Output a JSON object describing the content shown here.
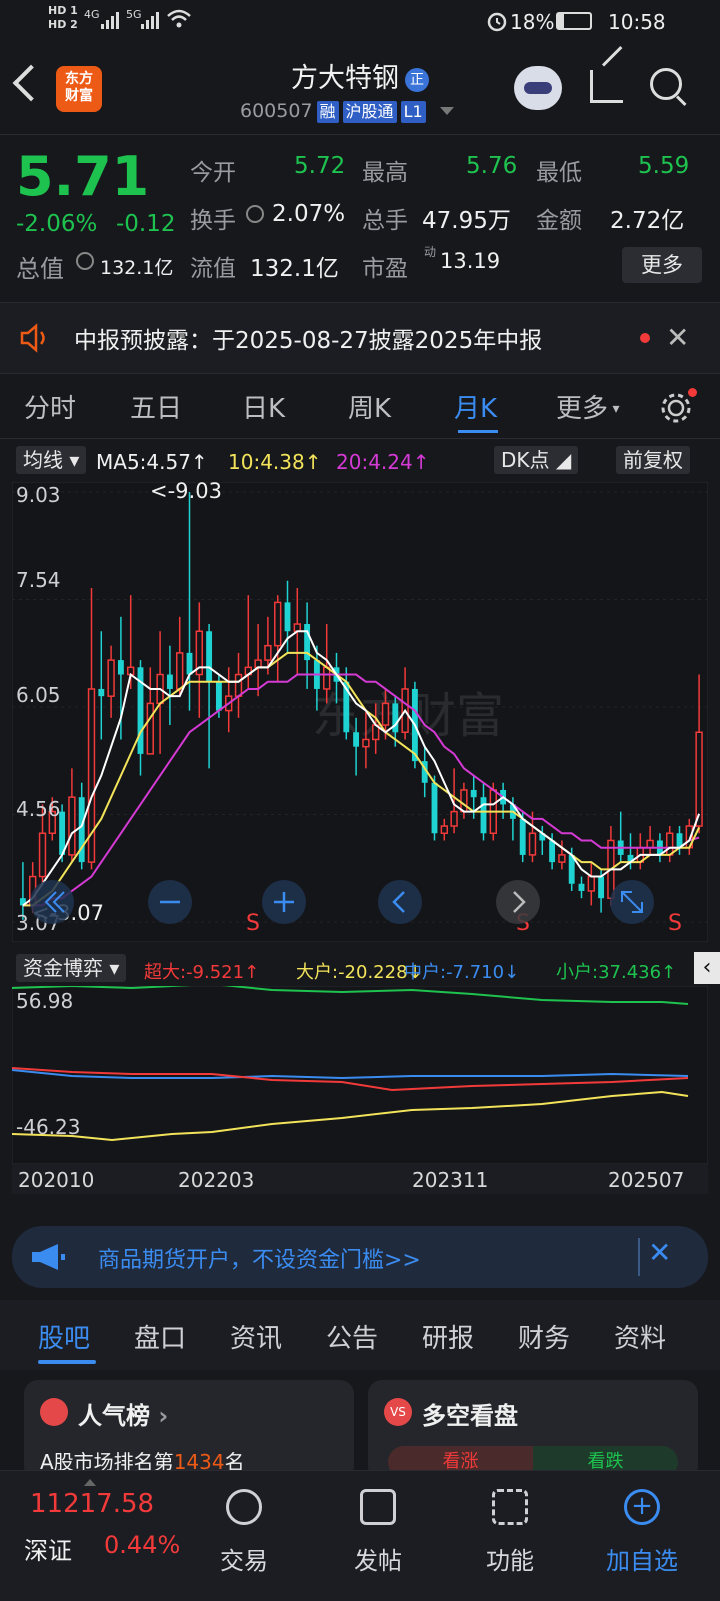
{
  "status": {
    "time": "10:58",
    "battery": "18%",
    "sim1": "HD 1",
    "sim2": "HD 2",
    "net1": "4G",
    "net2": "5G"
  },
  "header": {
    "name": "方大特钢",
    "badge": "正",
    "code": "600507",
    "tags": [
      "融",
      "沪股通",
      "L1"
    ],
    "logo": "东方\n财富"
  },
  "quote": {
    "price": "5.71",
    "change_pct": "-2.06%",
    "change": "-0.12",
    "open_label": "今开",
    "open": "5.72",
    "high_label": "最高",
    "high": "5.76",
    "low_label": "最低",
    "low": "5.59",
    "turnover_label": "换手",
    "turnover": "2.07%",
    "volume_label": "总手",
    "volume": "47.95万",
    "amount_label": "金额",
    "amount": "2.72亿",
    "mktcap_label": "总值",
    "mktcap": "132.1亿",
    "float_label": "流值",
    "float": "132.1亿",
    "pe_label": "市盈",
    "pe_sup": "动",
    "pe": "13.19",
    "more": "更多"
  },
  "notice": {
    "text": "中报预披露：于2025-08-27披露2025年中报"
  },
  "tabs": [
    "分时",
    "五日",
    "日K",
    "周K",
    "月K",
    "更多"
  ],
  "ma": {
    "selector": "均线",
    "ma5": "MA5:4.57↑",
    "ma10": "10:4.38↑",
    "ma20": "20:4.24↑",
    "dk": "DK点",
    "adjust": "前复权"
  },
  "chart_labels": {
    "y1": "9.03",
    "y2": "7.54",
    "y3": "6.05",
    "y4": "4.56",
    "y5": "3.07",
    "max_mark": "<-9.03",
    "min_mark": "<-3.07",
    "s_mark": "S"
  },
  "capital": {
    "selector": "资金博弈",
    "super": "超大:-9.521↑",
    "big": "大户:-20.228↓",
    "mid": "中户:-7.710↓",
    "small": "小户:37.436↑",
    "ytop": "56.98",
    "ybot": "-46.23"
  },
  "xaxis": [
    "202010",
    "202203",
    "202311",
    "202507"
  ],
  "ad": {
    "text": "商品期货开户，不设资金门槛>>"
  },
  "bottom_tabs": [
    "股吧",
    "盘口",
    "资讯",
    "公告",
    "研报",
    "财务",
    "资料"
  ],
  "cards": {
    "left_title": "人气榜",
    "left_sub_prefix": "A股市场排名第",
    "left_rank": "1434",
    "left_sub_suffix": "名",
    "right_title": "多空看盘",
    "up": "看涨",
    "down": "看跌"
  },
  "nav": {
    "index_value": "11217.58",
    "index_name": "深证",
    "index_pct": "0.44%",
    "items": [
      "交易",
      "发帖",
      "功能",
      "加自选"
    ]
  },
  "colors": {
    "up": "#f23a3a",
    "down": "#1ec24f",
    "accent": "#3b8cf0",
    "ma5": "#ffffff",
    "ma10": "#f2e35a",
    "ma20": "#d43ad4",
    "cap_super": "#f23a3a",
    "cap_big": "#f2e35a",
    "cap_mid": "#3b8cf0",
    "cap_small": "#1ec24f"
  },
  "chart_data": {
    "type": "candlestick",
    "ylim": [
      3.07,
      9.03
    ],
    "x_start": "202010",
    "x_end": "202507",
    "candles": [
      [
        3.4,
        3.3,
        3.9,
        3.1
      ],
      [
        3.3,
        3.7,
        3.9,
        3.2
      ],
      [
        3.7,
        4.3,
        4.7,
        3.6
      ],
      [
        4.3,
        4.6,
        4.8,
        4.2
      ],
      [
        4.6,
        4.0,
        4.7,
        3.9
      ],
      [
        4.0,
        4.8,
        5.2,
        3.9
      ],
      [
        4.8,
        3.9,
        5.0,
        3.8
      ],
      [
        3.9,
        6.3,
        7.7,
        3.8
      ],
      [
        6.3,
        6.2,
        7.1,
        5.6
      ],
      [
        6.2,
        6.7,
        6.9,
        5.9
      ],
      [
        6.7,
        6.5,
        7.3,
        5.6
      ],
      [
        6.5,
        6.6,
        7.6,
        6.3
      ],
      [
        6.6,
        5.4,
        6.7,
        5.1
      ],
      [
        5.4,
        6.1,
        6.6,
        5.4
      ],
      [
        6.1,
        6.5,
        7.1,
        5.4
      ],
      [
        6.5,
        6.3,
        6.9,
        5.8
      ],
      [
        6.3,
        6.8,
        7.3,
        6.2
      ],
      [
        6.8,
        6.5,
        9.03,
        6.0
      ],
      [
        6.5,
        7.1,
        7.5,
        5.9
      ],
      [
        7.1,
        6.4,
        7.2,
        5.2
      ],
      [
        6.4,
        6.0,
        6.5,
        5.9
      ],
      [
        6.0,
        6.2,
        6.6,
        5.7
      ],
      [
        6.2,
        6.5,
        6.8,
        5.9
      ],
      [
        6.5,
        6.6,
        7.6,
        6.3
      ],
      [
        6.6,
        6.7,
        7.2,
        6.2
      ],
      [
        6.7,
        6.9,
        7.3,
        6.5
      ],
      [
        6.9,
        7.5,
        7.6,
        6.4
      ],
      [
        7.5,
        7.1,
        7.8,
        6.8
      ],
      [
        7.1,
        7.2,
        7.7,
        6.5
      ],
      [
        7.2,
        6.7,
        7.5,
        6.3
      ],
      [
        6.7,
        6.3,
        6.9,
        6.0
      ],
      [
        6.3,
        6.6,
        7.2,
        6.1
      ],
      [
        6.6,
        6.4,
        6.8,
        6.1
      ],
      [
        6.4,
        5.7,
        6.6,
        5.6
      ],
      [
        5.7,
        5.5,
        5.9,
        5.1
      ],
      [
        5.5,
        5.6,
        6.0,
        5.2
      ],
      [
        5.6,
        5.8,
        6.1,
        5.4
      ],
      [
        5.8,
        6.1,
        6.3,
        5.6
      ],
      [
        6.1,
        5.7,
        6.2,
        5.5
      ],
      [
        5.7,
        6.3,
        6.6,
        5.6
      ],
      [
        6.3,
        5.3,
        6.4,
        5.2
      ],
      [
        5.3,
        5.0,
        5.5,
        4.8
      ],
      [
        5.0,
        4.3,
        5.1,
        4.2
      ],
      [
        4.3,
        4.4,
        4.5,
        4.2
      ],
      [
        4.4,
        4.6,
        5.2,
        4.3
      ],
      [
        4.6,
        4.9,
        5.0,
        4.5
      ],
      [
        4.9,
        4.8,
        5.1,
        4.5
      ],
      [
        4.8,
        4.3,
        5.0,
        4.2
      ],
      [
        4.3,
        4.9,
        5.0,
        4.2
      ],
      [
        4.9,
        4.7,
        5.0,
        4.5
      ],
      [
        4.7,
        4.5,
        4.8,
        4.2
      ],
      [
        4.5,
        4.0,
        4.6,
        3.9
      ],
      [
        4.0,
        4.3,
        4.6,
        3.9
      ],
      [
        4.3,
        4.2,
        4.4,
        4.0
      ],
      [
        4.2,
        3.9,
        4.3,
        3.8
      ],
      [
        3.9,
        4.0,
        4.2,
        3.8
      ],
      [
        4.0,
        3.6,
        4.1,
        3.5
      ],
      [
        3.6,
        3.5,
        3.7,
        3.4
      ],
      [
        3.5,
        3.7,
        3.9,
        3.3
      ],
      [
        3.7,
        3.4,
        3.8,
        3.2
      ],
      [
        3.4,
        4.2,
        4.4,
        3.3
      ],
      [
        4.2,
        4.0,
        4.6,
        3.9
      ],
      [
        4.0,
        3.9,
        4.3,
        3.8
      ],
      [
        3.9,
        4.1,
        4.3,
        3.8
      ],
      [
        4.1,
        4.2,
        4.4,
        4.0
      ],
      [
        4.2,
        4.0,
        4.3,
        3.9
      ],
      [
        4.0,
        4.3,
        4.4,
        3.9
      ],
      [
        4.3,
        4.1,
        4.4,
        4.0
      ],
      [
        4.1,
        4.4,
        4.5,
        4.0
      ],
      [
        4.4,
        5.7,
        6.5,
        4.3
      ]
    ],
    "ma5": [
      3.3,
      3.4,
      3.6,
      3.8,
      4.0,
      4.3,
      4.4,
      4.8,
      5.1,
      5.5,
      5.9,
      6.5,
      6.4,
      6.3,
      6.3,
      6.2,
      6.2,
      6.5,
      6.6,
      6.6,
      6.5,
      6.4,
      6.4,
      6.5,
      6.6,
      6.6,
      6.8,
      7.0,
      7.1,
      7.1,
      6.8,
      6.7,
      6.5,
      6.3,
      6.1,
      6.0,
      5.8,
      5.7,
      5.8,
      6.0,
      5.8,
      5.5,
      5.3,
      5.0,
      4.7,
      4.6,
      4.6,
      4.7,
      4.7,
      4.8,
      4.7,
      4.5,
      4.4,
      4.3,
      4.2,
      4.1,
      4.0,
      3.8,
      3.7,
      3.7,
      3.8,
      3.8,
      3.9,
      4.0,
      4.0,
      4.0,
      4.1,
      4.1,
      4.2,
      4.57
    ],
    "ma10": [
      3.3,
      3.3,
      3.4,
      3.5,
      3.7,
      3.9,
      4.1,
      4.3,
      4.5,
      4.8,
      5.1,
      5.4,
      5.7,
      5.9,
      6.1,
      6.2,
      6.3,
      6.4,
      6.4,
      6.4,
      6.4,
      6.4,
      6.4,
      6.5,
      6.6,
      6.6,
      6.7,
      6.8,
      6.8,
      6.8,
      6.7,
      6.6,
      6.5,
      6.4,
      6.2,
      6.0,
      5.9,
      5.7,
      5.6,
      5.5,
      5.4,
      5.2,
      5.0,
      4.9,
      4.8,
      4.7,
      4.6,
      4.6,
      4.6,
      4.6,
      4.6,
      4.5,
      4.4,
      4.3,
      4.2,
      4.1,
      4.0,
      3.9,
      3.9,
      3.8,
      3.8,
      3.9,
      3.9,
      3.9,
      4.0,
      4.0,
      4.0,
      4.1,
      4.1,
      4.38
    ],
    "ma20": [
      3.3,
      3.3,
      3.3,
      3.4,
      3.4,
      3.5,
      3.6,
      3.7,
      3.9,
      4.1,
      4.3,
      4.5,
      4.7,
      4.9,
      5.1,
      5.3,
      5.5,
      5.7,
      5.8,
      5.9,
      6.0,
      6.1,
      6.2,
      6.3,
      6.3,
      6.4,
      6.4,
      6.4,
      6.5,
      6.5,
      6.5,
      6.5,
      6.5,
      6.5,
      6.5,
      6.4,
      6.4,
      6.3,
      6.2,
      6.1,
      6.0,
      5.8,
      5.7,
      5.5,
      5.4,
      5.2,
      5.1,
      5.0,
      4.9,
      4.8,
      4.7,
      4.6,
      4.5,
      4.5,
      4.4,
      4.3,
      4.3,
      4.2,
      4.2,
      4.1,
      4.1,
      4.1,
      4.1,
      4.1,
      4.1,
      4.1,
      4.1,
      4.1,
      4.2,
      4.24
    ]
  }
}
